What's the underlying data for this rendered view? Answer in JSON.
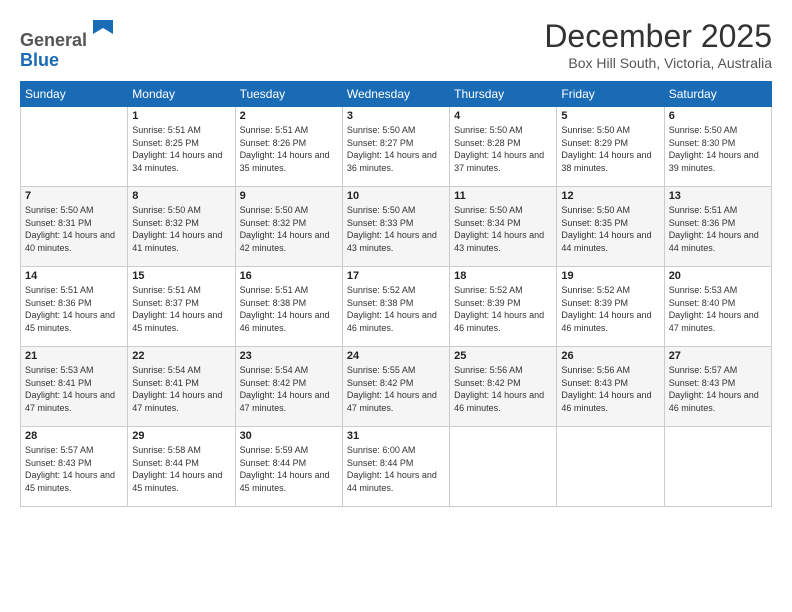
{
  "logo": {
    "general": "General",
    "blue": "Blue"
  },
  "header": {
    "month": "December 2025",
    "location": "Box Hill South, Victoria, Australia"
  },
  "weekdays": [
    "Sunday",
    "Monday",
    "Tuesday",
    "Wednesday",
    "Thursday",
    "Friday",
    "Saturday"
  ],
  "weeks": [
    [
      {
        "day": "",
        "sunrise": "",
        "sunset": "",
        "daylight": ""
      },
      {
        "day": "1",
        "sunrise": "Sunrise: 5:51 AM",
        "sunset": "Sunset: 8:25 PM",
        "daylight": "Daylight: 14 hours and 34 minutes."
      },
      {
        "day": "2",
        "sunrise": "Sunrise: 5:51 AM",
        "sunset": "Sunset: 8:26 PM",
        "daylight": "Daylight: 14 hours and 35 minutes."
      },
      {
        "day": "3",
        "sunrise": "Sunrise: 5:50 AM",
        "sunset": "Sunset: 8:27 PM",
        "daylight": "Daylight: 14 hours and 36 minutes."
      },
      {
        "day": "4",
        "sunrise": "Sunrise: 5:50 AM",
        "sunset": "Sunset: 8:28 PM",
        "daylight": "Daylight: 14 hours and 37 minutes."
      },
      {
        "day": "5",
        "sunrise": "Sunrise: 5:50 AM",
        "sunset": "Sunset: 8:29 PM",
        "daylight": "Daylight: 14 hours and 38 minutes."
      },
      {
        "day": "6",
        "sunrise": "Sunrise: 5:50 AM",
        "sunset": "Sunset: 8:30 PM",
        "daylight": "Daylight: 14 hours and 39 minutes."
      }
    ],
    [
      {
        "day": "7",
        "sunrise": "Sunrise: 5:50 AM",
        "sunset": "Sunset: 8:31 PM",
        "daylight": "Daylight: 14 hours and 40 minutes."
      },
      {
        "day": "8",
        "sunrise": "Sunrise: 5:50 AM",
        "sunset": "Sunset: 8:32 PM",
        "daylight": "Daylight: 14 hours and 41 minutes."
      },
      {
        "day": "9",
        "sunrise": "Sunrise: 5:50 AM",
        "sunset": "Sunset: 8:32 PM",
        "daylight": "Daylight: 14 hours and 42 minutes."
      },
      {
        "day": "10",
        "sunrise": "Sunrise: 5:50 AM",
        "sunset": "Sunset: 8:33 PM",
        "daylight": "Daylight: 14 hours and 43 minutes."
      },
      {
        "day": "11",
        "sunrise": "Sunrise: 5:50 AM",
        "sunset": "Sunset: 8:34 PM",
        "daylight": "Daylight: 14 hours and 43 minutes."
      },
      {
        "day": "12",
        "sunrise": "Sunrise: 5:50 AM",
        "sunset": "Sunset: 8:35 PM",
        "daylight": "Daylight: 14 hours and 44 minutes."
      },
      {
        "day": "13",
        "sunrise": "Sunrise: 5:51 AM",
        "sunset": "Sunset: 8:36 PM",
        "daylight": "Daylight: 14 hours and 44 minutes."
      }
    ],
    [
      {
        "day": "14",
        "sunrise": "Sunrise: 5:51 AM",
        "sunset": "Sunset: 8:36 PM",
        "daylight": "Daylight: 14 hours and 45 minutes."
      },
      {
        "day": "15",
        "sunrise": "Sunrise: 5:51 AM",
        "sunset": "Sunset: 8:37 PM",
        "daylight": "Daylight: 14 hours and 45 minutes."
      },
      {
        "day": "16",
        "sunrise": "Sunrise: 5:51 AM",
        "sunset": "Sunset: 8:38 PM",
        "daylight": "Daylight: 14 hours and 46 minutes."
      },
      {
        "day": "17",
        "sunrise": "Sunrise: 5:52 AM",
        "sunset": "Sunset: 8:38 PM",
        "daylight": "Daylight: 14 hours and 46 minutes."
      },
      {
        "day": "18",
        "sunrise": "Sunrise: 5:52 AM",
        "sunset": "Sunset: 8:39 PM",
        "daylight": "Daylight: 14 hours and 46 minutes."
      },
      {
        "day": "19",
        "sunrise": "Sunrise: 5:52 AM",
        "sunset": "Sunset: 8:39 PM",
        "daylight": "Daylight: 14 hours and 46 minutes."
      },
      {
        "day": "20",
        "sunrise": "Sunrise: 5:53 AM",
        "sunset": "Sunset: 8:40 PM",
        "daylight": "Daylight: 14 hours and 47 minutes."
      }
    ],
    [
      {
        "day": "21",
        "sunrise": "Sunrise: 5:53 AM",
        "sunset": "Sunset: 8:41 PM",
        "daylight": "Daylight: 14 hours and 47 minutes."
      },
      {
        "day": "22",
        "sunrise": "Sunrise: 5:54 AM",
        "sunset": "Sunset: 8:41 PM",
        "daylight": "Daylight: 14 hours and 47 minutes."
      },
      {
        "day": "23",
        "sunrise": "Sunrise: 5:54 AM",
        "sunset": "Sunset: 8:42 PM",
        "daylight": "Daylight: 14 hours and 47 minutes."
      },
      {
        "day": "24",
        "sunrise": "Sunrise: 5:55 AM",
        "sunset": "Sunset: 8:42 PM",
        "daylight": "Daylight: 14 hours and 47 minutes."
      },
      {
        "day": "25",
        "sunrise": "Sunrise: 5:56 AM",
        "sunset": "Sunset: 8:42 PM",
        "daylight": "Daylight: 14 hours and 46 minutes."
      },
      {
        "day": "26",
        "sunrise": "Sunrise: 5:56 AM",
        "sunset": "Sunset: 8:43 PM",
        "daylight": "Daylight: 14 hours and 46 minutes."
      },
      {
        "day": "27",
        "sunrise": "Sunrise: 5:57 AM",
        "sunset": "Sunset: 8:43 PM",
        "daylight": "Daylight: 14 hours and 46 minutes."
      }
    ],
    [
      {
        "day": "28",
        "sunrise": "Sunrise: 5:57 AM",
        "sunset": "Sunset: 8:43 PM",
        "daylight": "Daylight: 14 hours and 45 minutes."
      },
      {
        "day": "29",
        "sunrise": "Sunrise: 5:58 AM",
        "sunset": "Sunset: 8:44 PM",
        "daylight": "Daylight: 14 hours and 45 minutes."
      },
      {
        "day": "30",
        "sunrise": "Sunrise: 5:59 AM",
        "sunset": "Sunset: 8:44 PM",
        "daylight": "Daylight: 14 hours and 45 minutes."
      },
      {
        "day": "31",
        "sunrise": "Sunrise: 6:00 AM",
        "sunset": "Sunset: 8:44 PM",
        "daylight": "Daylight: 14 hours and 44 minutes."
      },
      {
        "day": "",
        "sunrise": "",
        "sunset": "",
        "daylight": ""
      },
      {
        "day": "",
        "sunrise": "",
        "sunset": "",
        "daylight": ""
      },
      {
        "day": "",
        "sunrise": "",
        "sunset": "",
        "daylight": ""
      }
    ]
  ]
}
